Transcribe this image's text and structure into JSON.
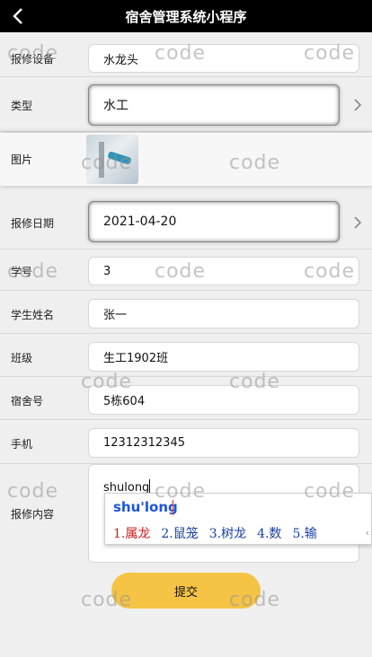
{
  "header": {
    "title": "宿舍管理系统小程序",
    "back_icon": "chevron-left-icon"
  },
  "fields": {
    "equipment": {
      "label": "报修设备",
      "value": "水龙头"
    },
    "type": {
      "label": "类型",
      "value": "水工"
    },
    "image": {
      "label": "图片"
    },
    "date": {
      "label": "报修日期",
      "value": "2021-04-20"
    },
    "student_id": {
      "label": "学号",
      "value": "3"
    },
    "student_name": {
      "label": "学生姓名",
      "value": "张一"
    },
    "class": {
      "label": "班级",
      "value": "生工1902班"
    },
    "dorm": {
      "label": "宿舍号",
      "value": "5栋604"
    },
    "phone": {
      "label": "手机",
      "value": "12312312345"
    },
    "content": {
      "label": "报修内容",
      "value": "shulong"
    }
  },
  "ime": {
    "pinyin": "shu'long",
    "candidates": [
      "1.属龙",
      "2.鼠笼",
      "3.树龙",
      "4.数",
      "5.输"
    ],
    "more_icon": "chevron-left-icon"
  },
  "submit_label": "提交",
  "watermark": "code"
}
